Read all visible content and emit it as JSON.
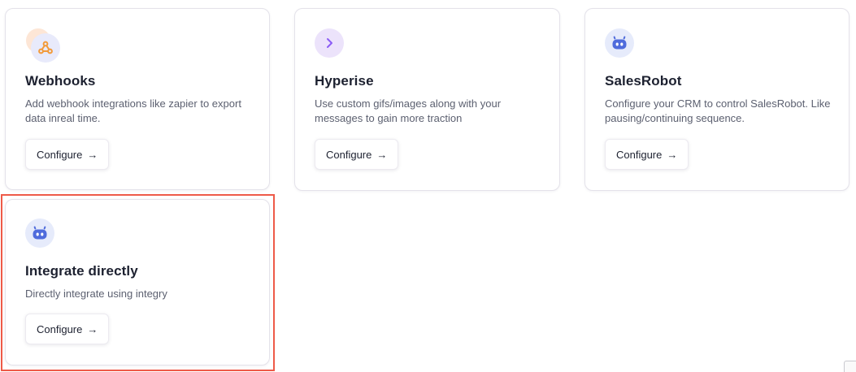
{
  "integrations": [
    {
      "title": "Webhooks",
      "description": "Add webhook integrations like zapier to export data inreal time.",
      "button_label": "Configure",
      "button_arrow": "→",
      "icon": "webhook-icon"
    },
    {
      "title": "Hyperise",
      "description": "Use custom gifs/images along with your messages to gain more traction",
      "button_label": "Configure",
      "button_arrow": "→",
      "icon": "chevron-right-icon"
    },
    {
      "title": "SalesRobot",
      "description": "Configure your CRM to control SalesRobot. Like pausing/continuing sequence.",
      "button_label": "Configure",
      "button_arrow": "→",
      "icon": "robot-icon"
    },
    {
      "title": "Integrate directly",
      "description": "Directly integrate using integry",
      "button_label": "Configure",
      "button_arrow": "→",
      "icon": "robot-icon"
    }
  ],
  "colors": {
    "highlight_border": "#ee5a48",
    "webhook_orange": "#f29a3a",
    "hyperise_purple": "#8b5cf6",
    "robot_blue": "#4f6bdc"
  }
}
